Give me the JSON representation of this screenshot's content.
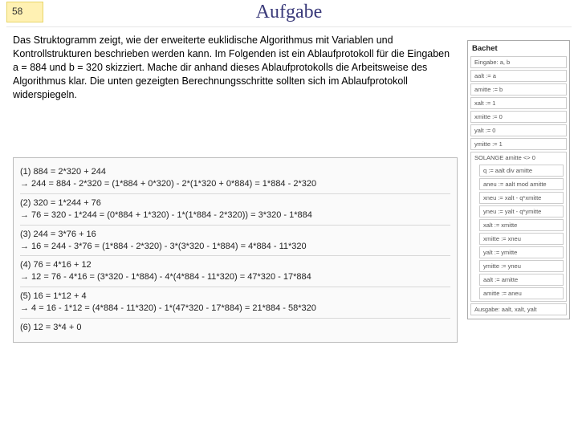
{
  "header": {
    "page_number": "58",
    "title": "Aufgabe"
  },
  "body": {
    "paragraph": "Das Struktogramm zeigt, wie der erweiterte euklidische Algorithmus mit Variablen und Kontrollstrukturen beschrieben werden kann. Im Folgenden ist ein Ablaufprotokoll für die Eingaben a = 884 und b = 320 skizziert. Mache dir anhand dieses Ablaufprotokolls die Arbeitsweise des Algorithmus klar. Die unten gezeigten Berechnungsschritte sollten sich im Ablaufprotokoll widerspiegeln."
  },
  "calculations": [
    {
      "num": "(1) 884 = 2*320 + 244",
      "arrow": "→ 244 = 884 - 2*320 = (1*884 + 0*320) - 2*(1*320 + 0*884) = 1*884 - 2*320"
    },
    {
      "num": "(2) 320 = 1*244 + 76",
      "arrow": "→ 76 = 320 - 1*244 = (0*884 + 1*320) - 1*(1*884 - 2*320)) = 3*320 - 1*884"
    },
    {
      "num": "(3) 244 = 3*76 + 16",
      "arrow": "→ 16 = 244 - 3*76 = (1*884 - 2*320) - 3*(3*320 - 1*884) = 4*884 - 11*320"
    },
    {
      "num": "(4) 76 = 4*16 + 12",
      "arrow": "→ 12 = 76 - 4*16 = (3*320 - 1*884) - 4*(4*884 - 11*320) = 47*320 - 17*884"
    },
    {
      "num": "(5) 16 = 1*12 + 4",
      "arrow": "→ 4 = 16 - 1*12 = (4*884 - 11*320) - 1*(47*320 - 17*884) = 21*884 - 58*320"
    },
    {
      "num": "(6) 12 = 3*4 + 0",
      "arrow": ""
    }
  ],
  "struktogramm": {
    "name": "Bachet",
    "input": "Eingabe: a, b",
    "init": [
      "aalt := a",
      "amitte := b",
      "xalt := 1",
      "xmitte := 0",
      "yalt := 0",
      "ymitte := 1"
    ],
    "loop_head": "SOLANGE amitte <> 0",
    "loop_body": [
      "q := aalt div amitte",
      "aneu := aalt mod amitte",
      "xneu := xalt - q*xmitte",
      "yneu := yalt - q*ymitte",
      "xalt := xmitte",
      "xmitte := xneu",
      "yalt := ymitte",
      "ymitte := yneu",
      "aalt := amitte",
      "amitte := aneu"
    ],
    "output": "Ausgabe: aalt, xalt, yalt"
  }
}
